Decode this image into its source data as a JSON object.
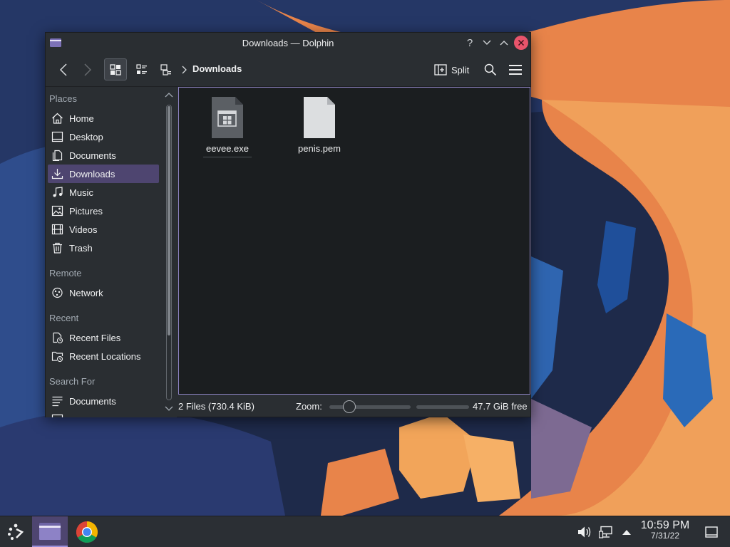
{
  "window": {
    "title": "Downloads — Dolphin",
    "help_icon": "question-mark-icon"
  },
  "toolbar": {
    "breadcrumb": "Downloads",
    "split_label": "Split",
    "icons": {
      "back": "chevron-left-icon",
      "forward": "chevron-right-icon",
      "view_icons": "grid-view-icon",
      "view_compact": "compact-view-icon",
      "view_details": "details-view-icon",
      "search": "magnifier-icon",
      "menu": "hamburger-menu-icon"
    }
  },
  "places": {
    "sections": {
      "places": "Places",
      "remote": "Remote",
      "recent": "Recent",
      "search_for": "Search For"
    },
    "items": [
      {
        "label": "Home",
        "icon": "home-icon"
      },
      {
        "label": "Desktop",
        "icon": "desktop-icon"
      },
      {
        "label": "Documents",
        "icon": "documents-icon"
      },
      {
        "label": "Downloads",
        "icon": "download-icon",
        "active": true
      },
      {
        "label": "Music",
        "icon": "music-icon"
      },
      {
        "label": "Pictures",
        "icon": "pictures-icon"
      },
      {
        "label": "Videos",
        "icon": "videos-icon"
      },
      {
        "label": "Trash",
        "icon": "trash-icon"
      }
    ],
    "remote_items": [
      {
        "label": "Network",
        "icon": "network-icon"
      }
    ],
    "recent_items": [
      {
        "label": "Recent Files",
        "icon": "recent-files-icon"
      },
      {
        "label": "Recent Locations",
        "icon": "recent-locations-icon"
      }
    ],
    "search_items": [
      {
        "label": "Documents",
        "icon": "documents-search-icon"
      }
    ]
  },
  "files": [
    {
      "name": "eevee.exe",
      "icon": "executable-file-icon"
    },
    {
      "name": "penis.pem",
      "icon": "generic-file-icon"
    }
  ],
  "status": {
    "file_count": "2 Files (730.4 KiB)",
    "zoom_label": "Zoom:",
    "free_space": "47.7 GiB free",
    "zoom_level_fraction": 0.2,
    "disk_used_fraction": 0.0
  },
  "taskbar": {
    "time": "10:59 PM",
    "date": "7/31/22",
    "icons": {
      "launcher": "steam-deck-launcher-icon",
      "dolphin": "dolphin-folder-icon",
      "chrome": "chrome-icon",
      "volume": "speaker-icon",
      "network": "network-wired-icon",
      "tray": "tray-arrow-up-icon",
      "desktop": "show-desktop-icon"
    }
  },
  "colors": {
    "accent": "#4e4570",
    "selection_border": "#8e84c4",
    "close_button": "#e9546b",
    "window_bg": "#2a2e32",
    "view_bg": "#1b1e20"
  }
}
